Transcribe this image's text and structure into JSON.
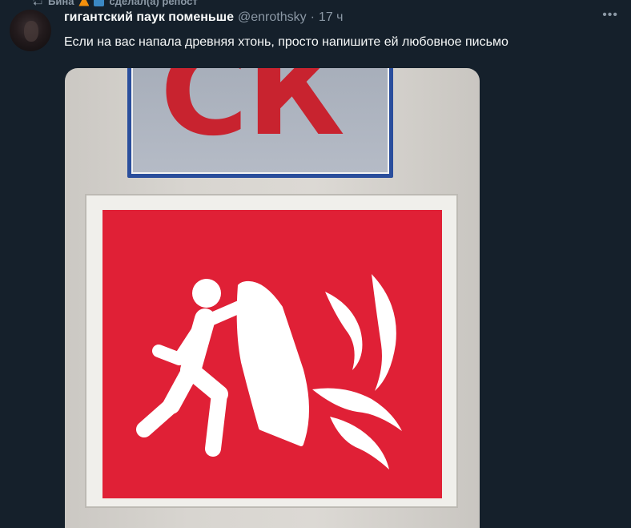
{
  "repost": {
    "label": "Бина",
    "suffix": "сделал(а) репост"
  },
  "author": {
    "name": "гигантский паук поменьше",
    "handle": "@enrothsky",
    "separator": "·",
    "time": "17 ч"
  },
  "tweet": {
    "text": "Если на вас напала древняя хтонь, просто напишите ей любовное письмо"
  },
  "media": {
    "top_sign_text": "СК"
  },
  "icons": {
    "repost": "repost-icon",
    "more": "more-icon",
    "person": "person-with-blanket-icon",
    "fire": "fire-icon"
  },
  "colors": {
    "background": "#15202b",
    "secondary_text": "#8b98a5",
    "sign_red": "#e02036",
    "sign_blue": "#2a4e9c"
  }
}
